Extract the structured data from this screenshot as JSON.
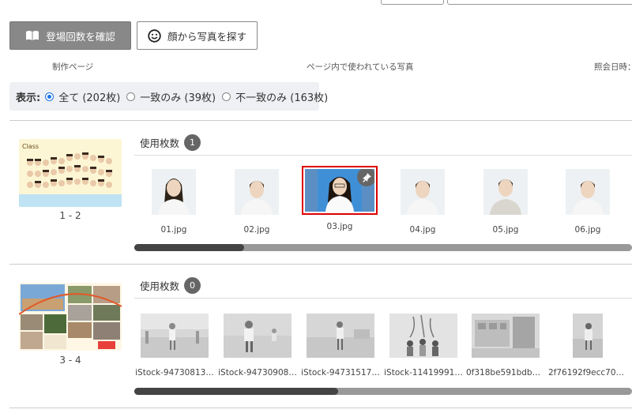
{
  "toolbar": {
    "check_count_label": "登場回数を確認",
    "face_search_label": "顔から写真を探す"
  },
  "headers": {
    "page": "制作ページ",
    "photos": "ページ内で使われている写真",
    "date": "照会日時："
  },
  "filter": {
    "label": "表示:",
    "options": [
      {
        "label": "全て (202枚)",
        "selected": true
      },
      {
        "label": "一致のみ (39枚)",
        "selected": false
      },
      {
        "label": "不一致のみ (163枚)",
        "selected": false
      }
    ]
  },
  "pages": [
    {
      "label": "1 - 2",
      "usage_label": "使用枚数",
      "usage_count": "1",
      "scroll_fraction": 0.22,
      "photos": [
        {
          "name": "01.jpg",
          "selected": false
        },
        {
          "name": "02.jpg",
          "selected": false
        },
        {
          "name": "03.jpg",
          "selected": true
        },
        {
          "name": "04.jpg",
          "selected": false
        },
        {
          "name": "05.jpg",
          "selected": false
        },
        {
          "name": "06.jpg",
          "selected": false
        }
      ]
    },
    {
      "label": "3 - 4",
      "usage_label": "使用枚数",
      "usage_count": "0",
      "scroll_fraction": 0.41,
      "photos": [
        {
          "name": "iStock-94730813…"
        },
        {
          "name": "iStock-94730908…"
        },
        {
          "name": "iStock-94731517…"
        },
        {
          "name": "iStock-11419991…"
        },
        {
          "name": "0f318be591bdba…"
        },
        {
          "name": "2f76192f9ecc70e…"
        }
      ]
    }
  ]
}
